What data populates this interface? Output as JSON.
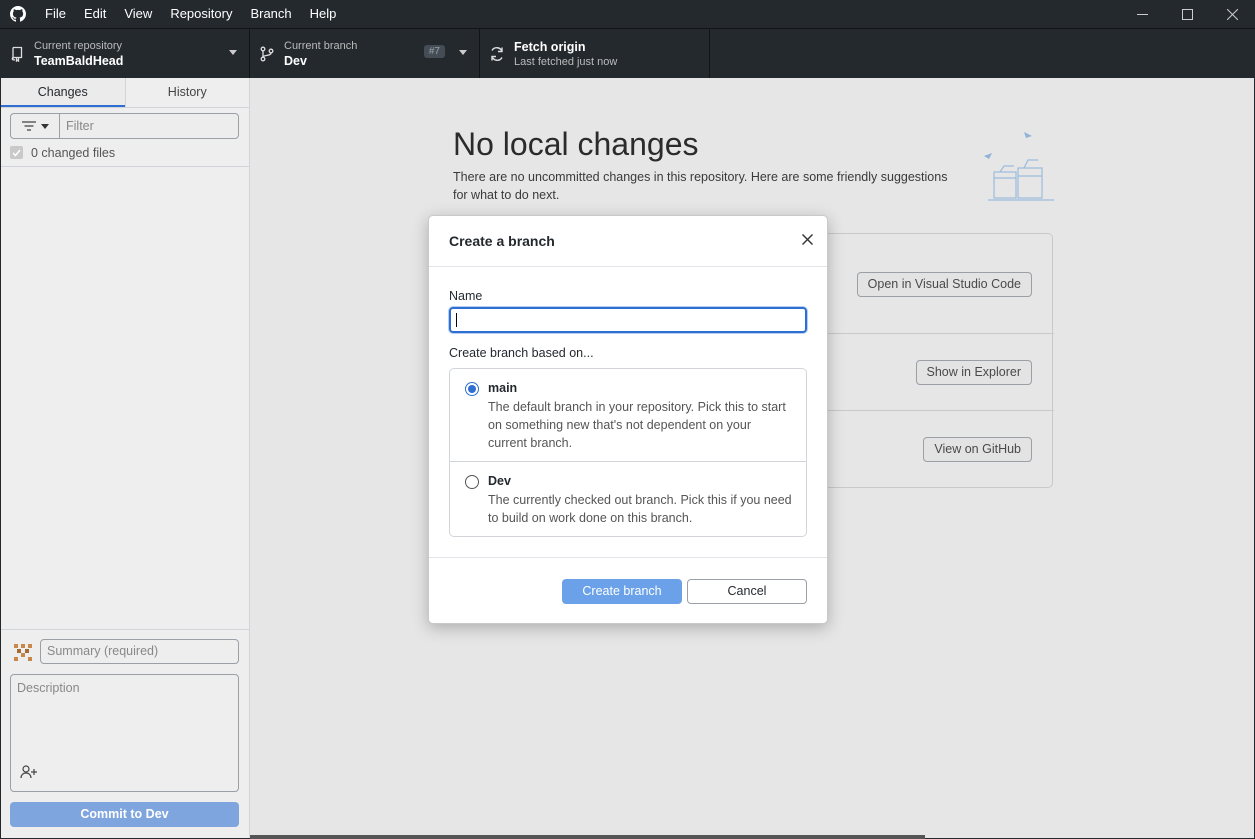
{
  "menu": [
    "File",
    "Edit",
    "View",
    "Repository",
    "Branch",
    "Help"
  ],
  "toolbar": {
    "repo_desc": "Current repository",
    "repo_name": "TeamBaldHead",
    "branch_desc": "Current branch",
    "branch_name": "Dev",
    "pr_badge": "#7",
    "fetch_title": "Fetch origin",
    "fetch_desc": "Last fetched just now"
  },
  "sidebar": {
    "tabs": [
      "Changes",
      "History"
    ],
    "filter_placeholder": "Filter",
    "changed_files": "0 changed files",
    "summary_placeholder": "Summary (required)",
    "description_placeholder": "Description",
    "commit_label": "Commit to Dev"
  },
  "main": {
    "title": "No local changes",
    "description": "There are no uncommitted changes in this repository. Here are some friendly suggestions for what to do next.",
    "actions": [
      "Open in Visual Studio Code",
      "Show in Explorer",
      "View on GitHub"
    ]
  },
  "dialog": {
    "title": "Create a branch",
    "name_label": "Name",
    "name_value": "",
    "based_on_label": "Create branch based on...",
    "options": [
      {
        "title": "main",
        "description": "The default branch in your repository. Pick this to start on something new that's not dependent on your current branch.",
        "selected": true
      },
      {
        "title": "Dev",
        "description": "The currently checked out branch. Pick this if you need to build on work done on this branch.",
        "selected": false
      }
    ],
    "create_label": "Create branch",
    "cancel_label": "Cancel"
  },
  "colors": {
    "accent": "#2f6fd1",
    "toolbar_bg": "#24292e",
    "create_btn": "#6aa1e8"
  }
}
